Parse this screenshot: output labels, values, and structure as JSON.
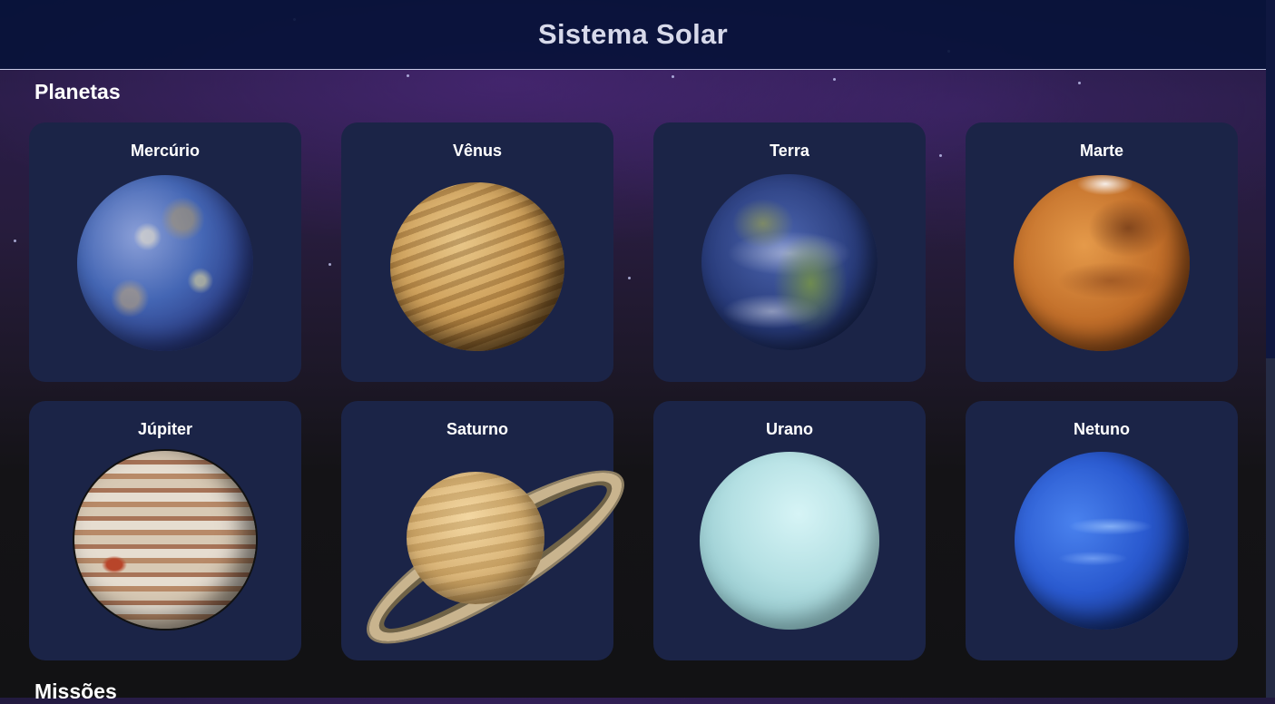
{
  "header": {
    "title": "Sistema Solar"
  },
  "sections": {
    "planets_title": "Planetas",
    "missions_title": "Missões"
  },
  "planets": [
    {
      "name": "Mercúrio",
      "icon": "mercury-image"
    },
    {
      "name": "Vênus",
      "icon": "venus-image"
    },
    {
      "name": "Terra",
      "icon": "earth-image"
    },
    {
      "name": "Marte",
      "icon": "mars-image"
    },
    {
      "name": "Júpiter",
      "icon": "jupiter-image"
    },
    {
      "name": "Saturno",
      "icon": "saturn-image"
    },
    {
      "name": "Urano",
      "icon": "uranus-image"
    },
    {
      "name": "Netuno",
      "icon": "neptune-image"
    }
  ],
  "colors": {
    "header_bg": "#08123a",
    "card_bg": "#1b2447",
    "text": "#ffffff"
  }
}
